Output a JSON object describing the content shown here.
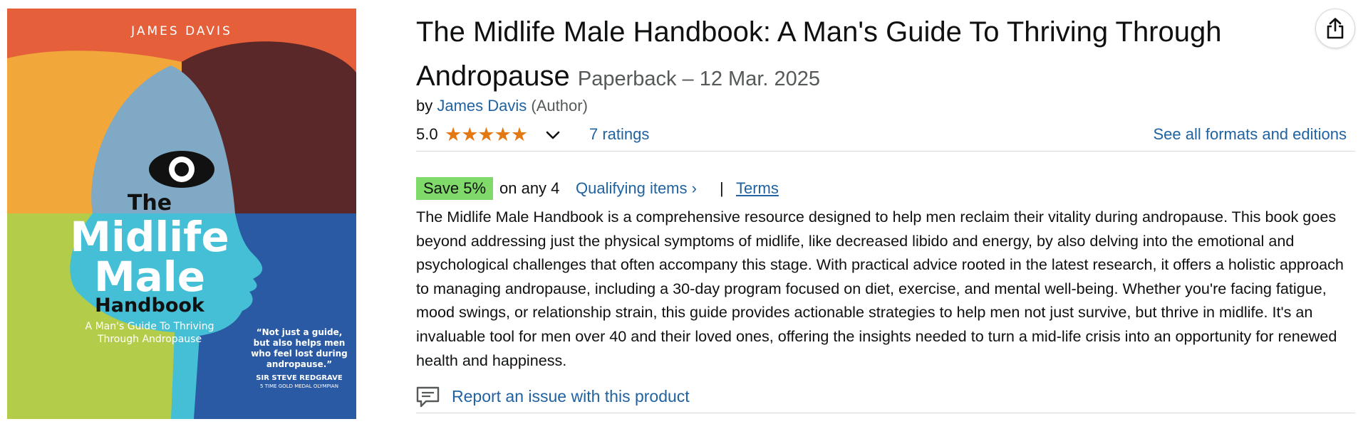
{
  "cover": {
    "author": "JAMES DAVIS",
    "the": "The",
    "midlife": "Midlife",
    "male": "Male",
    "handbook": "Handbook",
    "subtitle": "A Man's Guide To Thriving Through Andropause",
    "quote": "“Not just a guide, but also helps men who feel lost during andropause.”",
    "quote_author": "SIR STEVE REDGRAVE",
    "quote_author_sub": "5 TIME GOLD MEDAL OLYMPIAN"
  },
  "product": {
    "title": "The Midlife Male Handbook: A Man's Guide To Thriving Through Andropause",
    "format": "Paperback – 12 Mar. 2025",
    "by": "by",
    "author": "James Davis",
    "author_role": "(Author)",
    "rating_value": "5.0",
    "stars": "★★★★★",
    "ratings_count": "7 ratings",
    "formats_link": "See all formats and editions"
  },
  "promo": {
    "badge": "Save 5%",
    "text": "on any 4",
    "qualifying": "Qualifying items ›",
    "separator": "|",
    "terms": "Terms"
  },
  "description": "The Midlife Male Handbook is a comprehensive resource designed to help men reclaim their vitality during andropause. This book goes beyond addressing just the physical symptoms of midlife, like decreased libido and energy, by also delving into the emotional and psychological challenges that often accompany this stage. With practical advice rooted in the latest research, it offers a holistic approach to managing andropause, including a 30-day program focused on diet, exercise, and mental well-being. Whether you're facing fatigue, mood swings, or relationship strain, this guide provides actionable strategies to help men not just survive, but thrive in midlife. It's an invaluable tool for men over 40 and their loved ones, offering the insights needed to turn a mid-life crisis into an opportunity for renewed health and happiness.",
  "report": {
    "label": "Report an issue with this product",
    "icon": "comment-flag-icon"
  },
  "share": {
    "icon": "share-icon"
  },
  "colors": {
    "link": "#2162a1",
    "star": "#e47911",
    "save_badge": "#7fda69",
    "cover_orange_red": "#e65f3b",
    "cover_yellow": "#f1a73a",
    "cover_maroon": "#5a2828",
    "cover_blue": "#2a5aa3",
    "cover_green": "#b3cd4a",
    "cover_cyan": "#45bfd6",
    "cover_head": "#7fa9c4"
  }
}
